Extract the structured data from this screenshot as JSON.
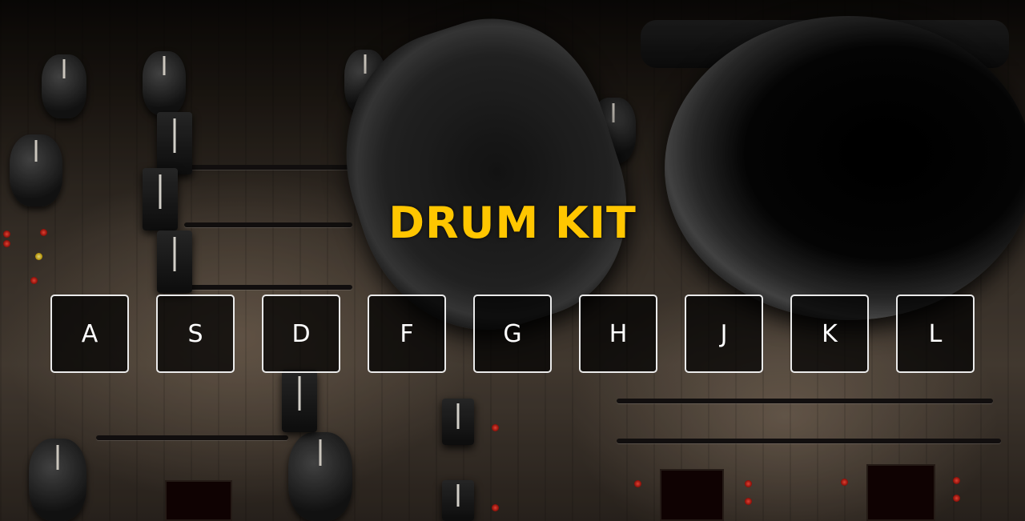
{
  "title": "DRUM KIT",
  "keys": [
    {
      "label": "A"
    },
    {
      "label": "S"
    },
    {
      "label": "D"
    },
    {
      "label": "F"
    },
    {
      "label": "G"
    },
    {
      "label": "H"
    },
    {
      "label": "J"
    },
    {
      "label": "K"
    },
    {
      "label": "L"
    }
  ],
  "colors": {
    "title": "#ffc600",
    "key_border": "#eaeaea",
    "key_text": "#ffffff"
  },
  "background": "mixer-and-headphones-photo"
}
